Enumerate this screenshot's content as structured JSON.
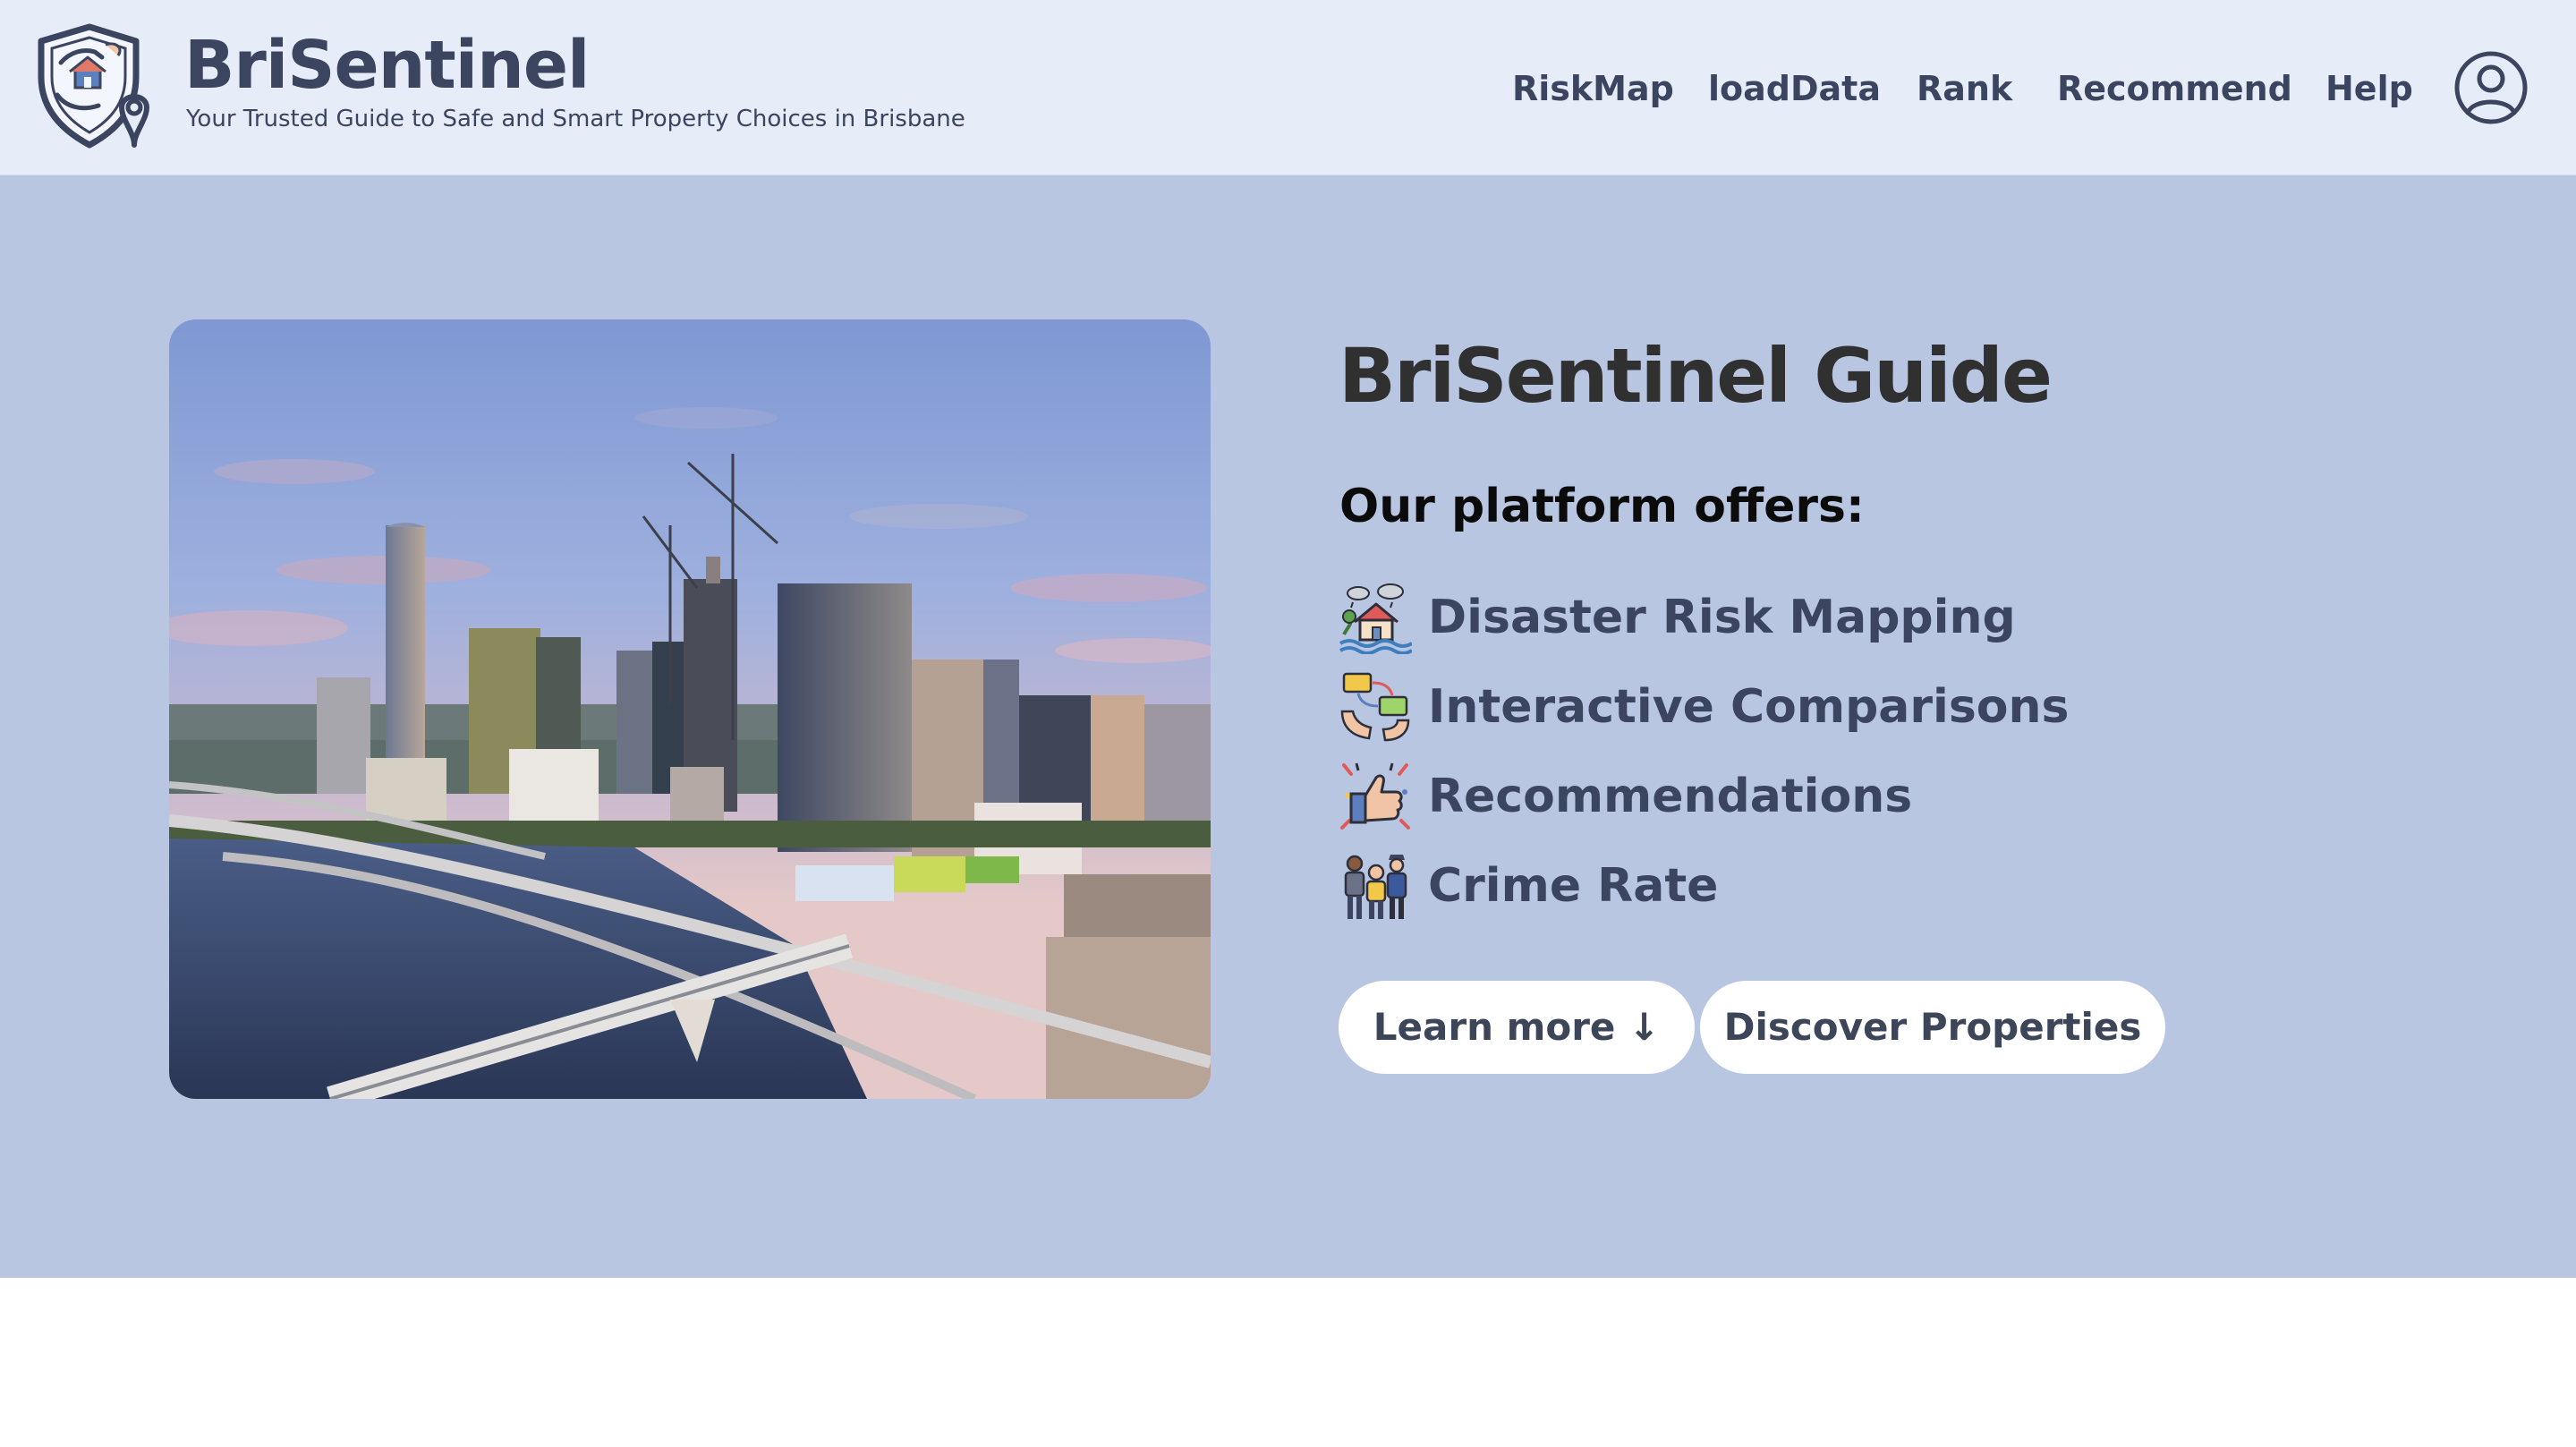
{
  "header": {
    "brand_name": "BriSentinel",
    "tagline": "Your Trusted Guide to Safe and Smart Property Choices in Brisbane",
    "nav": [
      {
        "label": "RiskMap"
      },
      {
        "label": "loadData"
      },
      {
        "label": "Rank"
      },
      {
        "label": "Recommend"
      },
      {
        "label": "Help"
      }
    ],
    "user_icon": "user-circle-icon"
  },
  "hero": {
    "title": "BriSentinel Guide",
    "offers_heading": "Our platform offers:",
    "features": [
      {
        "label": "Disaster Risk Mapping",
        "icon": "disaster-house-icon"
      },
      {
        "label": "Interactive Comparisons",
        "icon": "comparison-hands-icon"
      },
      {
        "label": "Recommendations",
        "icon": "thumbs-up-icon"
      },
      {
        "label": "Crime Rate",
        "icon": "police-people-icon"
      }
    ],
    "buttons": {
      "learn_more": "Learn more ↓",
      "discover": "Discover Properties"
    }
  },
  "colors": {
    "header_bg": "#e6edf8",
    "hero_bg": "#b9c6e1",
    "brand_text": "#3b4560",
    "heading_text": "#303030",
    "button_bg": "#ffffff"
  }
}
